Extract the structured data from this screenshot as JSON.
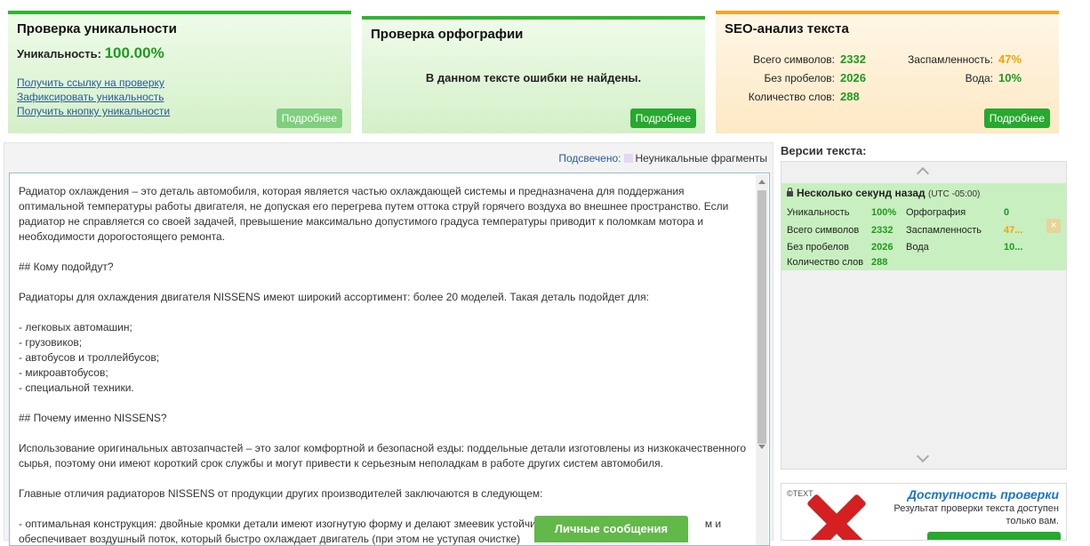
{
  "uniqueness": {
    "title": "Проверка уникальности",
    "label": "Уникальность:",
    "value": "100.00%",
    "links": [
      "Получить ссылку на проверку",
      "Зафиксировать уникальность",
      "Получить кнопку уникальности"
    ],
    "more_label": "Подробнее"
  },
  "spelling": {
    "title": "Проверка орфографии",
    "message": "В данном тексте ошибки не найдены.",
    "more_label": "Подробнее"
  },
  "seo": {
    "title": "SEO-анализ текста",
    "chars_label": "Всего символов:",
    "chars": "2332",
    "nospace_label": "Без пробелов:",
    "nospace": "2026",
    "words_label": "Количество слов:",
    "words": "288",
    "spam_label": "Заспамленность:",
    "spam": "47%",
    "water_label": "Вода:",
    "water": "10%",
    "more_label": "Подробнее"
  },
  "legend": {
    "lead": "Подсвечено:",
    "label": "Неуникальные фрагменты"
  },
  "editor": {
    "text": "Радиатор охлаждения – это деталь автомобиля, которая является частью охлаждающей системы и предназначена для поддержания оптимальной температуры работы двигателя, не допуская его перегрева путем оттока струй горячего воздуха во внешнее пространство. Если радиатор не справляется со своей задачей, превышение максимально допустимого градуса температуры приводит к поломкам мотора и необходимости дорогостоящего ремонта.\n\n## Кому подойдут?\n\nРадиаторы для охлаждения двигателя NISSENS имеют широкий ассортимент: более 20 моделей. Такая деталь подойдет для:\n\n- легковых автомашин;\n- грузовиков;\n- автобусов и троллейбусов;\n- микроавтобусов;\n- специальной техники.\n\n## Почему именно NISSENS?\n\nИспользование оригинальных автозапчастей – это залог комфортной и безопасной езды: поддельные детали изготовлены из низкокачественного сырья, поэтому они имеют короткий срок службы и могут привести к серьезным неполадкам в работе других систем автомобиля.\n\nГлавные отличия радиаторов NISSENS от продукции других производителей заключаются в следующем:\n\n- оптимальная конструкция: двойные кромки детали имеют изогнутую форму и делают змеевик устойчи                                                         м и\nобеспечивает воздушный поток, который быстро охлаждает двигатель (при этом не уступая очистке)"
  },
  "messages_button": "Личные сообщения",
  "versions": {
    "title": "Версии текста:",
    "entry": {
      "time": "Несколько секунд назад",
      "tz": "(UTC -05:00)",
      "uniq_label": "Уникальность",
      "uniq": "100%",
      "spell_label": "Орфография",
      "spell": "0",
      "chars_label": "Всего символов",
      "chars": "2332",
      "spam_label": "Заспамленность",
      "spam": "47...",
      "nospace_label": "Без пробелов",
      "nospace": "2026",
      "water_label": "Вода",
      "water": "10...",
      "words_label": "Количество слов",
      "words": "288"
    }
  },
  "ad": {
    "logo": "©TEXT",
    "title": "Доступность проверки",
    "subtitle": "Результат проверки текста доступен только вам."
  },
  "colors": {
    "accent_green": "#2fb52f",
    "button_green": "#27a82f",
    "warn_orange": "#f5a000",
    "link_blue": "#2a5a9a"
  }
}
